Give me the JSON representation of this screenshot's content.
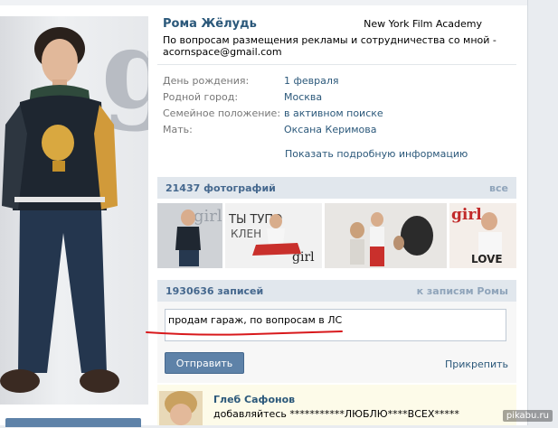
{
  "profile": {
    "name": "Рома Жёлудь",
    "school": "New York Film Academy",
    "status": "По вопросам размещения рекламы и сотрудничества со мной - acornspace@gmail.com",
    "info": [
      {
        "label": "День рождения:",
        "value": "1 февраля"
      },
      {
        "label": "Родной город:",
        "value": "Москва"
      },
      {
        "label": "Семейное положение:",
        "value": "в активном поиске"
      },
      {
        "label": "Мать:",
        "value": "Оксана Керимова"
      }
    ],
    "show_more": "Показать подробную информацию"
  },
  "photos": {
    "title": "21437 фотографий",
    "all_link": "все"
  },
  "wall": {
    "title": "1930636 записей",
    "link": "к записям Ромы",
    "input_value": "продам гараж, по вопросам в ЛС",
    "send_label": "Отправить",
    "attach_label": "Прикрепить"
  },
  "post": {
    "author": "Глеб Сафонов",
    "text": "добавляйтесь ***********ЛЮБЛЮ****ВСЕХ*****"
  },
  "watermark": "pikabu.ru",
  "colors": {
    "link": "#2b587a",
    "section_bar": "#e1e7ed",
    "button": "#5e82a8",
    "annotation": "#d8191c"
  }
}
